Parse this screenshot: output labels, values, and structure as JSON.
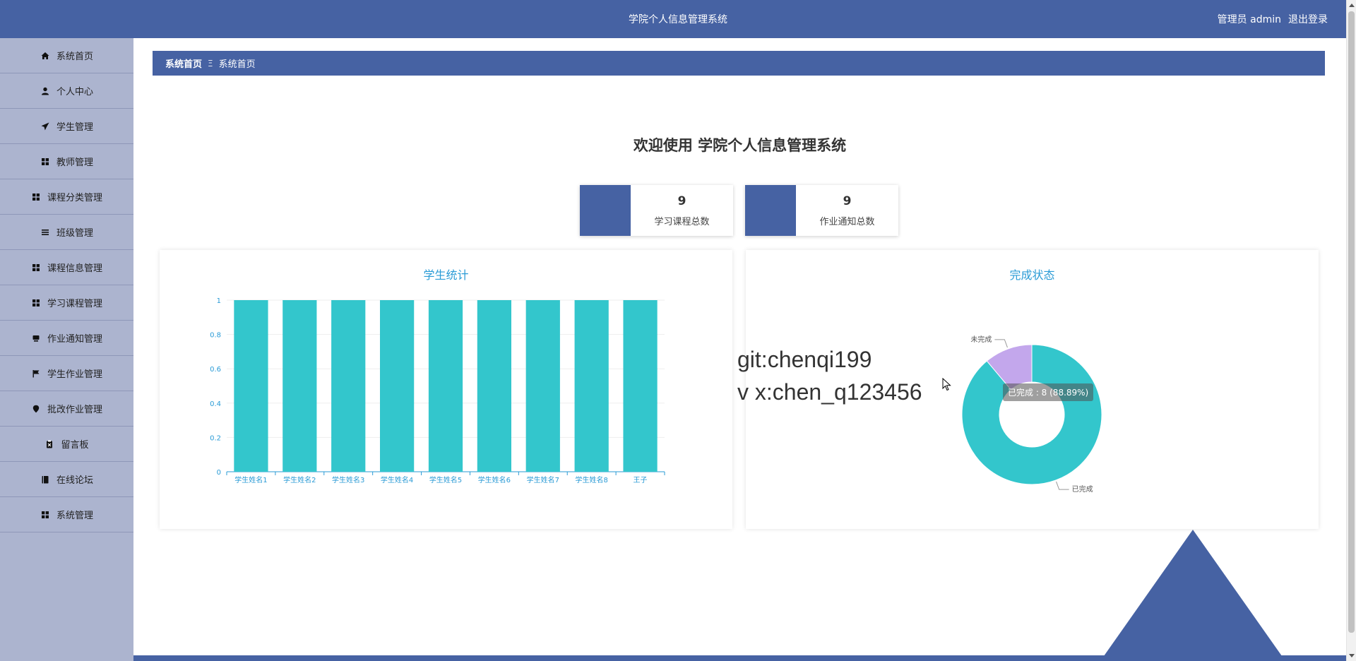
{
  "header": {
    "title": "学院个人信息管理系统",
    "user_label": "管理员 admin",
    "logout_label": "退出登录"
  },
  "sidebar": {
    "items": [
      {
        "label": "系统首页",
        "icon": "home-icon"
      },
      {
        "label": "个人中心",
        "icon": "user-icon"
      },
      {
        "label": "学生管理",
        "icon": "send-icon"
      },
      {
        "label": "教师管理",
        "icon": "grid-icon"
      },
      {
        "label": "课程分类管理",
        "icon": "grid-icon"
      },
      {
        "label": "班级管理",
        "icon": "list-icon"
      },
      {
        "label": "课程信息管理",
        "icon": "grid-icon"
      },
      {
        "label": "学习课程管理",
        "icon": "grid-icon"
      },
      {
        "label": "作业通知管理",
        "icon": "inbox-icon"
      },
      {
        "label": "学生作业管理",
        "icon": "flag-icon"
      },
      {
        "label": "批改作业管理",
        "icon": "pin-icon"
      },
      {
        "label": "留言板",
        "icon": "clipboard-icon"
      },
      {
        "label": "在线论坛",
        "icon": "book-icon"
      },
      {
        "label": "系统管理",
        "icon": "grid-icon"
      }
    ]
  },
  "breadcrumb": {
    "item1": "系统首页",
    "separator": "Ξ",
    "item2": "系统首页"
  },
  "welcome": "欢迎使用 学院个人信息管理系统",
  "stats": [
    {
      "value": "9",
      "label": "学习课程总数"
    },
    {
      "value": "9",
      "label": "作业通知总数"
    }
  ],
  "watermark": {
    "line1": "git:chenqi199",
    "line2": "v x:chen_q123456"
  },
  "colors": {
    "primary": "#4662a3",
    "bar": "#33c6cc",
    "pie_done": "#33c6cc",
    "pie_undone": "#c3a7ec",
    "title_blue": "#2a9bd6"
  },
  "chart_data": [
    {
      "type": "bar",
      "title": "学生统计",
      "categories": [
        "学生姓名1",
        "学生姓名2",
        "学生姓名3",
        "学生姓名4",
        "学生姓名5",
        "学生姓名6",
        "学生姓名7",
        "学生姓名8",
        "王子"
      ],
      "values": [
        1,
        1,
        1,
        1,
        1,
        1,
        1,
        1,
        1
      ],
      "ylim": [
        0,
        1
      ],
      "yticks": [
        "0",
        "0.2",
        "0.4",
        "0.6",
        "0.8",
        "1"
      ],
      "xlabel": "",
      "ylabel": "",
      "grid": true
    },
    {
      "type": "pie",
      "title": "完成状态",
      "slices": [
        {
          "name": "已完成",
          "value": 8
        },
        {
          "name": "未完成",
          "value": 1
        }
      ],
      "tooltip": "已完成 : 8 (88.89%)"
    }
  ]
}
